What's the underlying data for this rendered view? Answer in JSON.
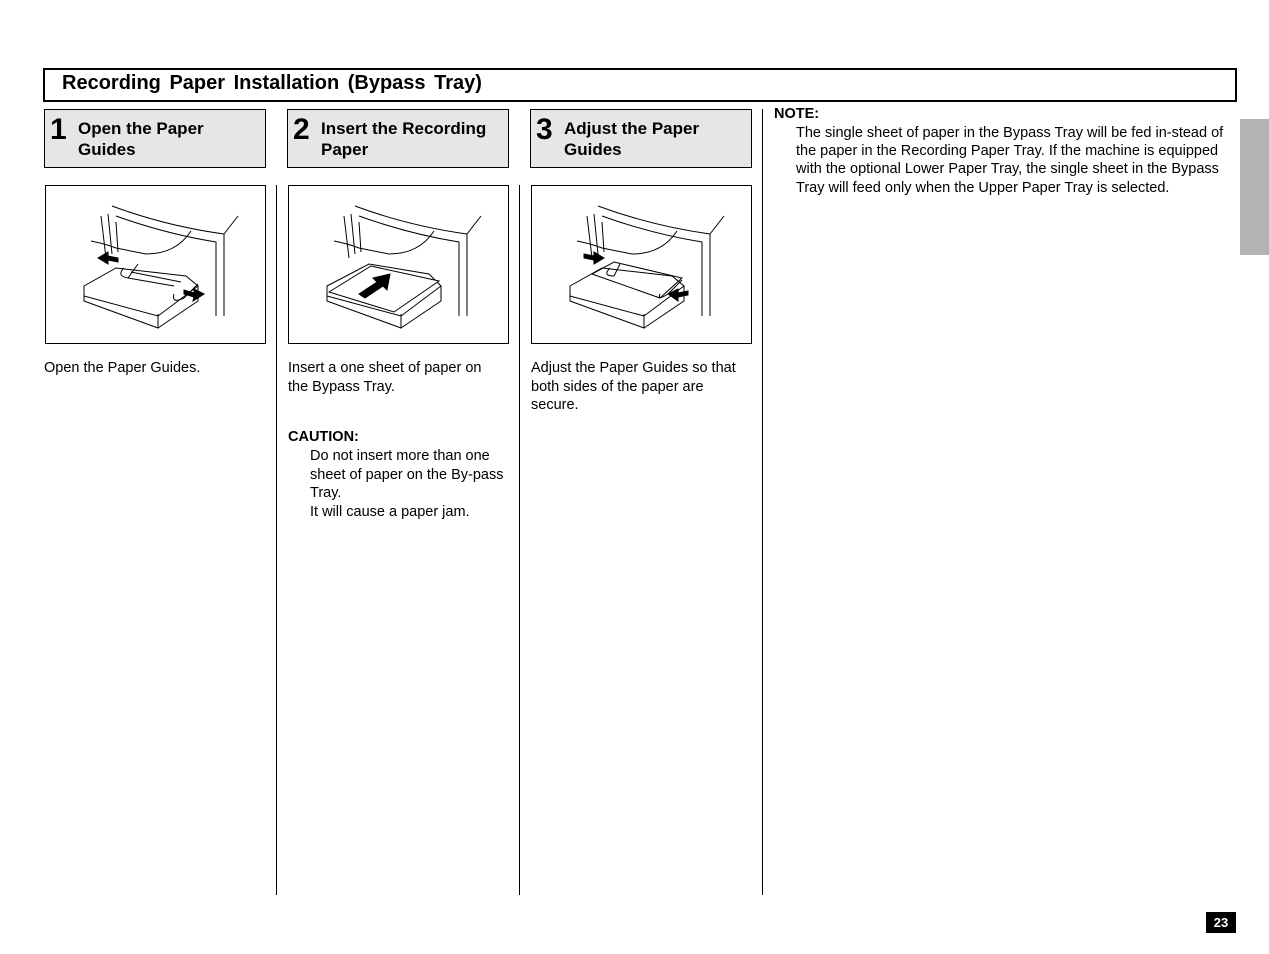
{
  "page": {
    "title": "Recording Paper Installation (Bypass Tray)",
    "page_number": "23"
  },
  "steps": [
    {
      "number": "1",
      "title": "Open the Paper Guides",
      "illustration": "printer-bypass-tray-guides-open-icon",
      "description": "Open the Paper Guides."
    },
    {
      "number": "2",
      "title": "Insert the Recording Paper",
      "illustration": "printer-bypass-tray-insert-paper-icon",
      "description": "Insert a one sheet of paper on the Bypass Tray.",
      "caution": {
        "label": "CAUTION:",
        "lines": [
          "Do not insert more than one sheet of paper on the By-pass Tray.",
          "It will cause a paper jam."
        ]
      }
    },
    {
      "number": "3",
      "title": "Adjust the Paper Guides",
      "illustration": "printer-bypass-tray-guides-adjust-icon",
      "description": "Adjust the Paper Guides so that both sides of the paper are secure."
    }
  ],
  "note": {
    "label": "NOTE:",
    "text": "The single sheet of paper in the Bypass Tray will be fed in-stead of the paper in the Recording Paper Tray. If the machine is equipped with the optional Lower Paper Tray, the single sheet in the Bypass Tray will feed only when the Upper Paper Tray is selected."
  }
}
